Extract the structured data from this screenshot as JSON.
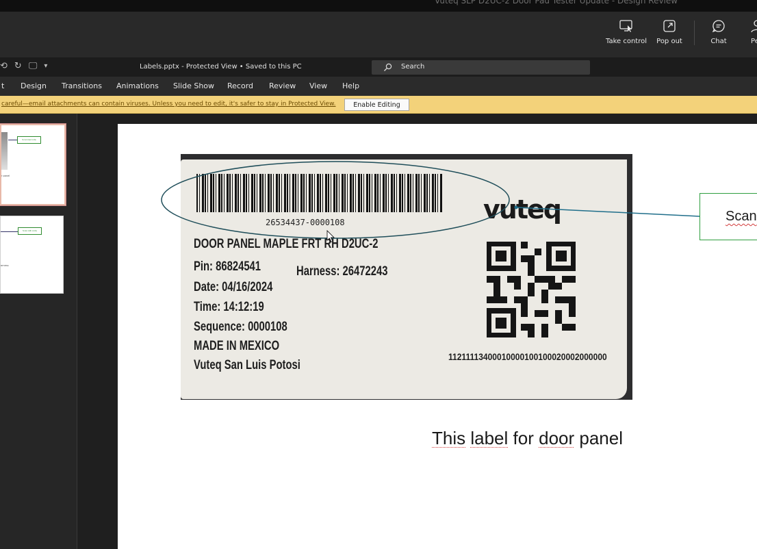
{
  "meeting": {
    "title": "Vuteq SLP D2UC-2 Door Pad Tester Update - Design Review",
    "controls": [
      {
        "label": "Take control",
        "icon": "take-control-icon"
      },
      {
        "label": "Pop out",
        "icon": "pop-out-icon"
      },
      {
        "label": "Chat",
        "icon": "chat-icon"
      },
      {
        "label": "Peo",
        "icon": "people-icon"
      }
    ]
  },
  "ppt": {
    "document_title": "Labels.pptx  -  Protected View • Saved to this PC",
    "search_placeholder": "Search",
    "tabs": [
      "t",
      "Design",
      "Transitions",
      "Animations",
      "Slide Show",
      "Record",
      "Review",
      "View",
      "Help"
    ],
    "protected_message": "careful—email attachments can contain viruses. Unless you need to edit, it's safer to stay in Protected View.",
    "enable_editing_label": "Enable Editing"
  },
  "thumbnails": [
    {
      "callout": "Scan barcode",
      "caption": "r panel"
    },
    {
      "callout": "Scan QR code",
      "caption": "arness"
    }
  ],
  "slide": {
    "label": {
      "barcode_number": "26534437-0000108",
      "lines": [
        "DOOR PANEL MAPLE FRT RH D2UC-2",
        "Pin: 86824541",
        "Date: 04/16/2024",
        "Time: 14:12:19",
        "Sequence: 0000108",
        "MADE IN MEXICO",
        "Vuteq San Luis Potosi"
      ],
      "harness": "Harness: 26472243",
      "brand": "vuteq",
      "qr_number": "11211113400010000100100020002000000"
    },
    "callout_text": "Scan",
    "caption": {
      "w1": "This",
      "w2": "label",
      "w3": "for",
      "w4": "door",
      "w5": "panel"
    }
  },
  "colors": {
    "protected_bar": "#f3d27a",
    "callout_border": "#2e9e3e",
    "ellipse": "#1f4e5a",
    "thumb_selected": "#e8b9a8"
  }
}
